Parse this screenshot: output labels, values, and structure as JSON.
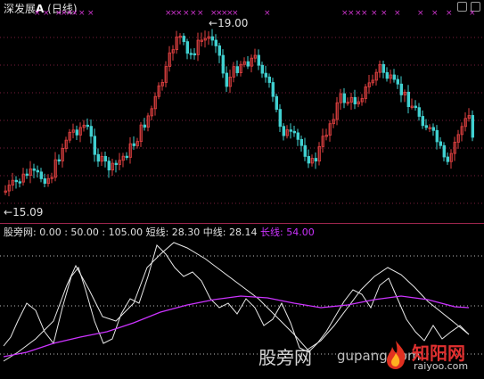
{
  "header": {
    "title": "深发展",
    "mark": "A",
    "period": "(日线)"
  },
  "price_panel": {
    "high_label": "19.00",
    "low_label": "15.09"
  },
  "indicator": {
    "name": "股旁网",
    "levels_text": ": 0.00 : 50.00 : 105.00",
    "short_label": "短线:",
    "short_value": "28.30",
    "mid_label": "中线:",
    "mid_value": "28.14",
    "long_label": "长线:",
    "long_value": "54.00"
  },
  "watermark": {
    "site": "股旁网",
    "url": "gupang.com",
    "logo_cn": "知阳网",
    "logo_sub": "raiyoo.com"
  },
  "colors": {
    "background": "#000000",
    "up_candle": "#e04040",
    "down_candle": "#40d0d0",
    "long_line": "#cc33ff",
    "divider": "#a0264f"
  },
  "chart_data": {
    "type": "line",
    "series": [
      {
        "name": "短线",
        "last": 28.3
      },
      {
        "name": "中线",
        "last": 28.14
      },
      {
        "name": "长线",
        "last": 54.0
      }
    ],
    "reference_levels": [
      0,
      50,
      105
    ]
  }
}
